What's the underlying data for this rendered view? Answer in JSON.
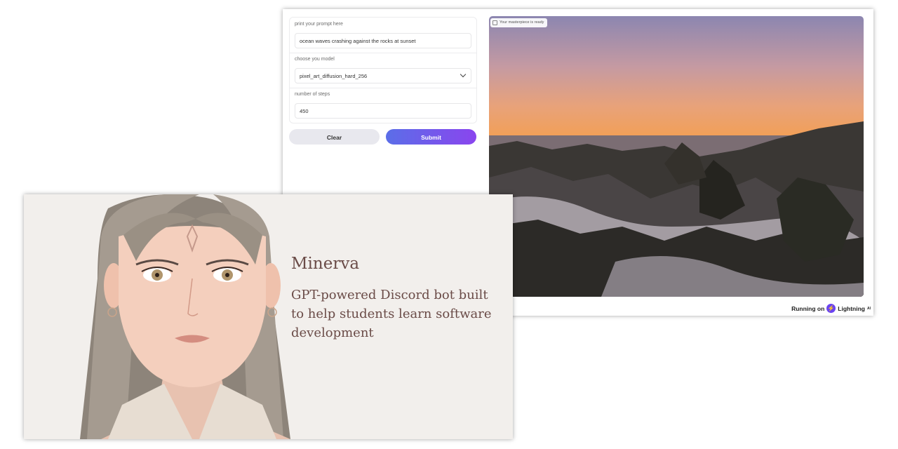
{
  "app": {
    "prompt": {
      "label": "print your prompt here",
      "value": "ocean waves crashing against the rocks at sunset"
    },
    "model": {
      "label": "choose you model",
      "value": "pixel_art_diffusion_hard_256"
    },
    "steps": {
      "label": "number of steps",
      "value": "450"
    },
    "buttons": {
      "clear": "Clear",
      "submit": "Submit"
    },
    "output": {
      "badge": "Your masterpiece is ready"
    },
    "footer": {
      "running_on": "Running on",
      "brand": "Lightning",
      "brand_sup": "AI"
    }
  },
  "minerva": {
    "title": "Minerva",
    "tagline": "GPT-powered Discord bot built to help students learn software development"
  },
  "colors": {
    "submit_start": "#5b6ee8",
    "submit_end": "#8a45ee",
    "card_bg": "#f2efec",
    "title_text": "#6a4b47"
  },
  "icons": [
    "image-icon",
    "chevron-down-icon",
    "lightning-logo-icon"
  ]
}
